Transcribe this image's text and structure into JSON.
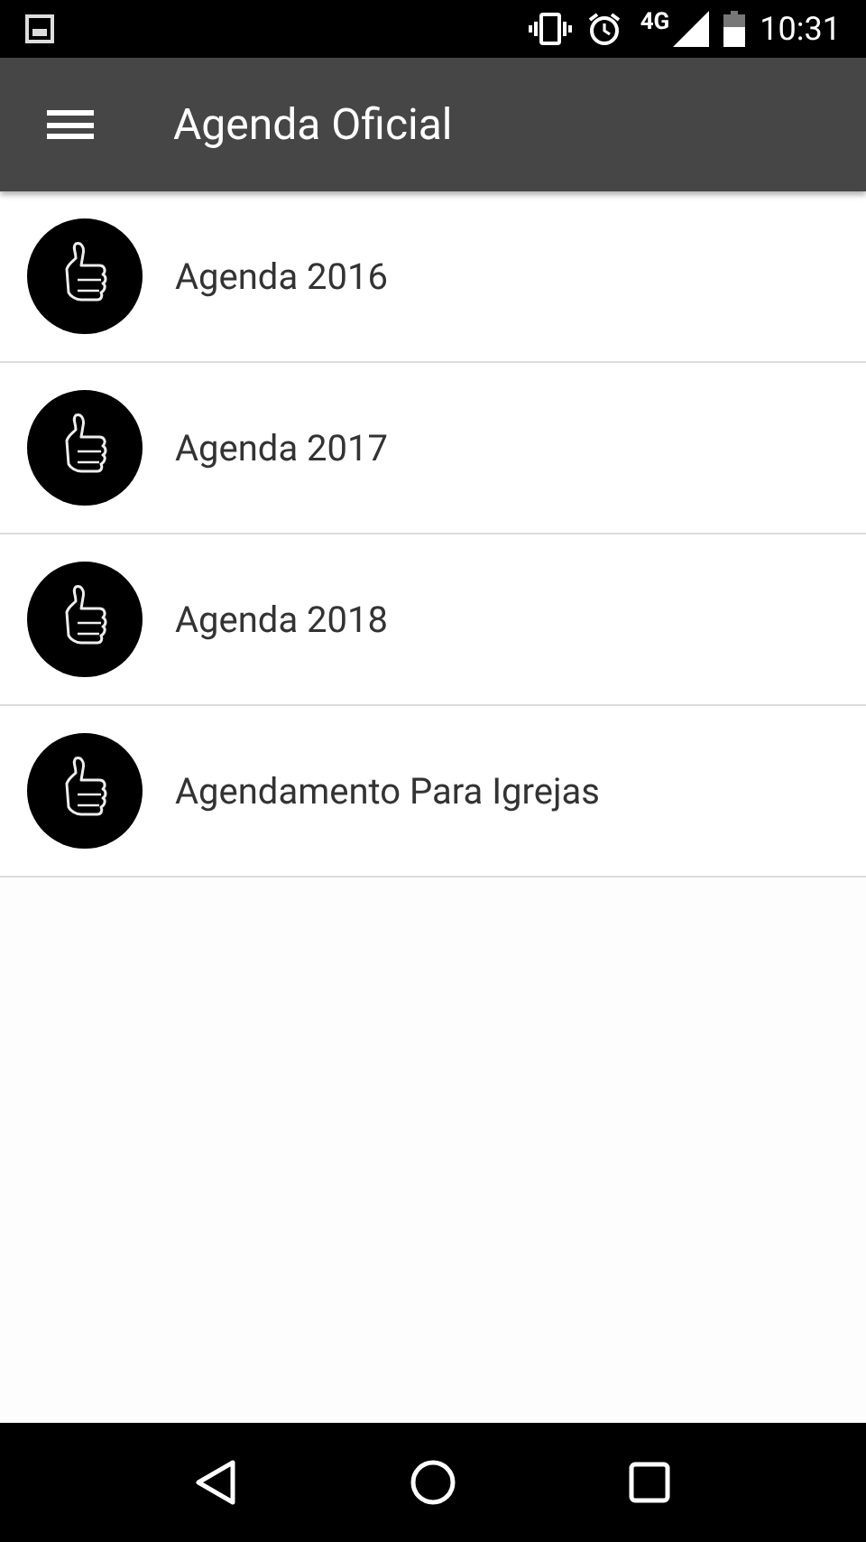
{
  "status_bar": {
    "network": "4G",
    "time": "10:31"
  },
  "toolbar": {
    "title": "Agenda Oficial"
  },
  "items": [
    {
      "label": "Agenda 2016"
    },
    {
      "label": "Agenda 2017"
    },
    {
      "label": "Agenda 2018"
    },
    {
      "label": "Agendamento Para Igrejas"
    }
  ]
}
